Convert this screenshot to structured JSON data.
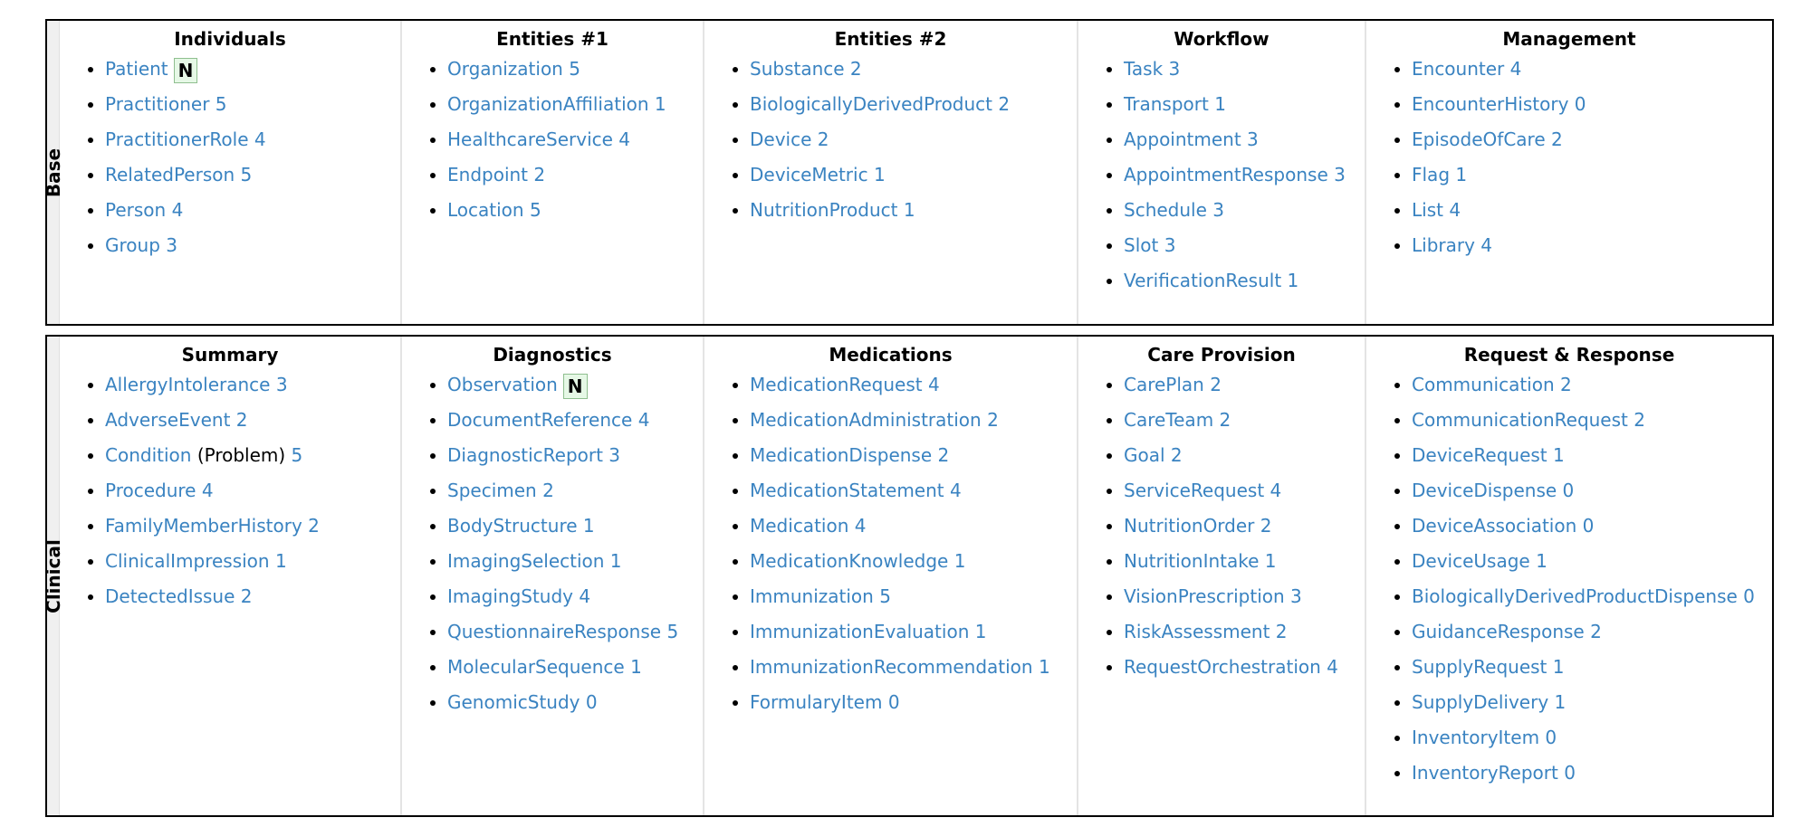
{
  "sections": [
    {
      "label": "Base",
      "columns": [
        {
          "title": "Individuals",
          "items": [
            {
              "name": "Patient",
              "badge": "N"
            },
            {
              "name": "Practitioner",
              "count": "5"
            },
            {
              "name": "PractitionerRole",
              "count": "4"
            },
            {
              "name": "RelatedPerson",
              "count": "5"
            },
            {
              "name": "Person",
              "count": "4"
            },
            {
              "name": "Group",
              "count": "3"
            }
          ]
        },
        {
          "title": "Entities #1",
          "items": [
            {
              "name": "Organization",
              "count": "5"
            },
            {
              "name": "OrganizationAffiliation",
              "count": "1"
            },
            {
              "name": "HealthcareService",
              "count": "4"
            },
            {
              "name": "Endpoint",
              "count": "2"
            },
            {
              "name": "Location",
              "count": "5"
            }
          ]
        },
        {
          "title": "Entities #2",
          "items": [
            {
              "name": "Substance",
              "count": "2"
            },
            {
              "name": "BiologicallyDerivedProduct",
              "count": "2"
            },
            {
              "name": "Device",
              "count": "2"
            },
            {
              "name": "DeviceMetric",
              "count": "1"
            },
            {
              "name": "NutritionProduct",
              "count": "1"
            }
          ]
        },
        {
          "title": "Workflow",
          "items": [
            {
              "name": "Task",
              "count": "3"
            },
            {
              "name": "Transport",
              "count": "1"
            },
            {
              "name": "Appointment",
              "count": "3"
            },
            {
              "name": "AppointmentResponse",
              "count": "3"
            },
            {
              "name": "Schedule",
              "count": "3"
            },
            {
              "name": "Slot",
              "count": "3"
            },
            {
              "name": "VerificationResult",
              "count": "1"
            }
          ]
        },
        {
          "title": "Management",
          "items": [
            {
              "name": "Encounter",
              "count": "4"
            },
            {
              "name": "EncounterHistory",
              "count": "0"
            },
            {
              "name": "EpisodeOfCare",
              "count": "2"
            },
            {
              "name": "Flag",
              "count": "1"
            },
            {
              "name": "List",
              "count": "4"
            },
            {
              "name": "Library",
              "count": "4"
            }
          ]
        }
      ]
    },
    {
      "label": "Clinical",
      "columns": [
        {
          "title": "Summary",
          "items": [
            {
              "name": "AllergyIntolerance",
              "count": "3"
            },
            {
              "name": "AdverseEvent",
              "count": "2"
            },
            {
              "name": "Condition",
              "note": "(Problem)",
              "count": "5"
            },
            {
              "name": "Procedure",
              "count": "4"
            },
            {
              "name": "FamilyMemberHistory",
              "count": "2"
            },
            {
              "name": "ClinicalImpression",
              "count": "1"
            },
            {
              "name": "DetectedIssue",
              "count": "2"
            }
          ]
        },
        {
          "title": "Diagnostics",
          "items": [
            {
              "name": "Observation",
              "badge": "N"
            },
            {
              "name": "DocumentReference",
              "count": "4"
            },
            {
              "name": "DiagnosticReport",
              "count": "3"
            },
            {
              "name": "Specimen",
              "count": "2"
            },
            {
              "name": "BodyStructure",
              "count": "1"
            },
            {
              "name": "ImagingSelection",
              "count": "1"
            },
            {
              "name": "ImagingStudy",
              "count": "4"
            },
            {
              "name": "QuestionnaireResponse",
              "count": "5"
            },
            {
              "name": "MolecularSequence",
              "count": "1"
            },
            {
              "name": "GenomicStudy",
              "count": "0"
            }
          ]
        },
        {
          "title": "Medications",
          "items": [
            {
              "name": "MedicationRequest",
              "count": "4"
            },
            {
              "name": "MedicationAdministration",
              "count": "2"
            },
            {
              "name": "MedicationDispense",
              "count": "2"
            },
            {
              "name": "MedicationStatement",
              "count": "4"
            },
            {
              "name": "Medication",
              "count": "4"
            },
            {
              "name": "MedicationKnowledge",
              "count": "1"
            },
            {
              "name": "Immunization",
              "count": "5"
            },
            {
              "name": "ImmunizationEvaluation",
              "count": "1"
            },
            {
              "name": "ImmunizationRecommendation",
              "count": "1"
            },
            {
              "name": "FormularyItem",
              "count": "0"
            }
          ]
        },
        {
          "title": "Care Provision",
          "items": [
            {
              "name": "CarePlan",
              "count": "2"
            },
            {
              "name": "CareTeam",
              "count": "2"
            },
            {
              "name": "Goal",
              "count": "2"
            },
            {
              "name": "ServiceRequest",
              "count": "4"
            },
            {
              "name": "NutritionOrder",
              "count": "2"
            },
            {
              "name": "NutritionIntake",
              "count": "1"
            },
            {
              "name": "VisionPrescription",
              "count": "3"
            },
            {
              "name": "RiskAssessment",
              "count": "2"
            },
            {
              "name": "RequestOrchestration",
              "count": "4"
            }
          ]
        },
        {
          "title": "Request & Response",
          "items": [
            {
              "name": "Communication",
              "count": "2"
            },
            {
              "name": "CommunicationRequest",
              "count": "2"
            },
            {
              "name": "DeviceRequest",
              "count": "1"
            },
            {
              "name": "DeviceDispense",
              "count": "0"
            },
            {
              "name": "DeviceAssociation",
              "count": "0"
            },
            {
              "name": "DeviceUsage",
              "count": "1"
            },
            {
              "name": "BiologicallyDerivedProductDispense",
              "count": "0"
            },
            {
              "name": "GuidanceResponse",
              "count": "2"
            },
            {
              "name": "SupplyRequest",
              "count": "1"
            },
            {
              "name": "SupplyDelivery",
              "count": "1"
            },
            {
              "name": "InventoryItem",
              "count": "0"
            },
            {
              "name": "InventoryReport",
              "count": "0"
            }
          ]
        }
      ]
    }
  ],
  "colors": {
    "link": "#3a83c1",
    "badge_bg": "#e6f8e6",
    "badge_border": "#8fbf8f",
    "side_bar": "#f0f0f0"
  }
}
